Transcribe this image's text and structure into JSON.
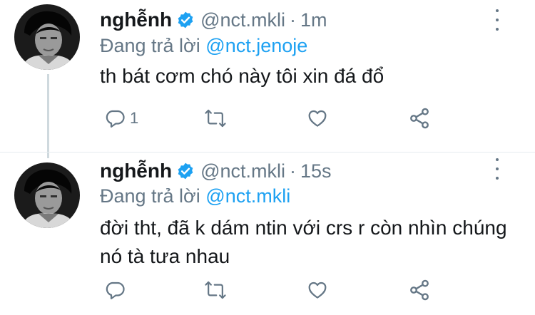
{
  "tweets": [
    {
      "display_name": "nghễnh",
      "handle": "@nct.mkli",
      "separator": "·",
      "time": "1m",
      "replying_prefix": "Đang trả lời",
      "replying_to": "@nct.jenoje",
      "text": "th bát cơm chó này tôi xin đá đổ",
      "reply_count": "1",
      "retweet_count": "",
      "like_count": ""
    },
    {
      "display_name": "nghễnh",
      "handle": "@nct.mkli",
      "separator": "·",
      "time": "15s",
      "replying_prefix": "Đang trả lời",
      "replying_to": "@nct.mkli",
      "text": "đời tht, đã k dám ntin với crs r còn nhìn chúng nó tà tưa nhau",
      "reply_count": "",
      "retweet_count": "",
      "like_count": ""
    }
  ],
  "icons": [
    "verified-badge-icon",
    "more-options-icon",
    "reply-icon",
    "retweet-icon",
    "like-icon",
    "share-icon"
  ],
  "colors": {
    "text": "#14171a",
    "secondary": "#657786",
    "link": "#1da1f2",
    "verified": "#1da1f2",
    "thread_line": "#cfd9de"
  }
}
